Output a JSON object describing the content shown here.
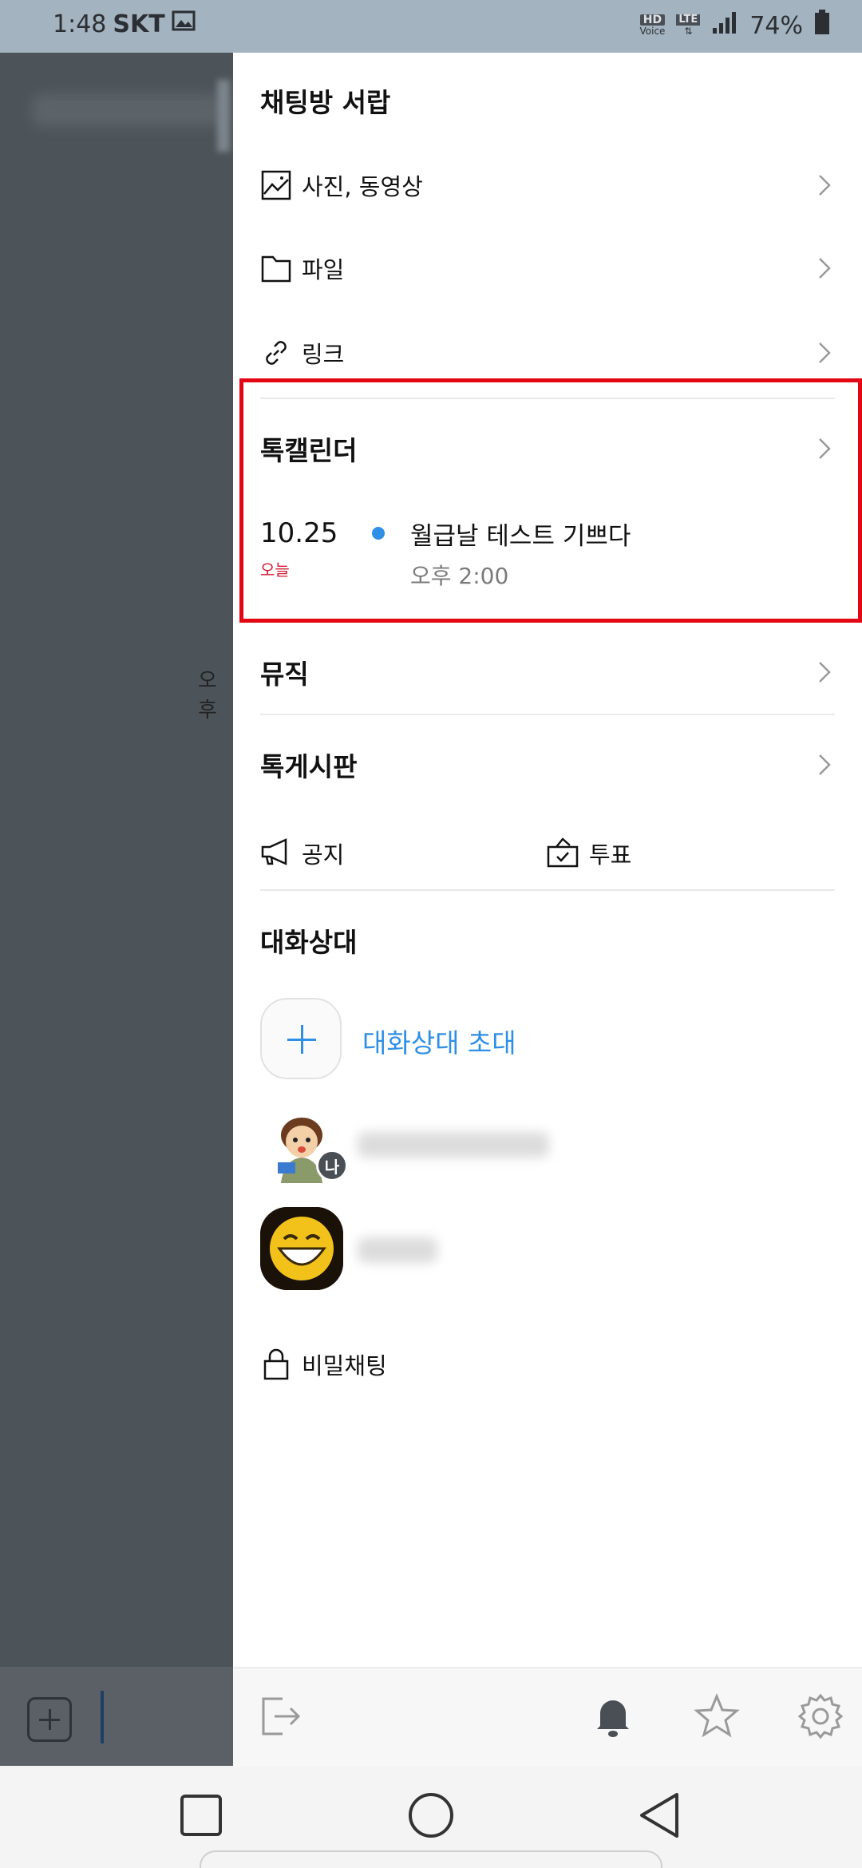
{
  "status_bar": {
    "time": "1:48",
    "carrier": "SKT",
    "hd_voice": "HD",
    "voice": "Voice",
    "lte": "LTE",
    "battery": "74%"
  },
  "background": {
    "time_stub": "오후"
  },
  "drawer": {
    "title": "채팅방 서랍",
    "items": [
      {
        "label": "사진, 동영상",
        "icon": "photo-icon"
      },
      {
        "label": "파일",
        "icon": "folder-icon"
      },
      {
        "label": "링크",
        "icon": "link-icon"
      }
    ],
    "calendar": {
      "title": "톡캘린더",
      "date": "10.25",
      "today_label": "오늘",
      "event_title": "월급날 테스트 기쁘다",
      "event_time": "오후 2:00"
    },
    "music": {
      "title": "뮤직"
    },
    "board": {
      "title": "톡게시판",
      "notice_label": "공지",
      "vote_label": "투표"
    },
    "members": {
      "title": "대화상대",
      "invite_label": "대화상대 초대",
      "me_badge": "나"
    },
    "secret_chat_label": "비밀채팅"
  },
  "colors": {
    "accent_blue": "#2f8fe6",
    "today_red": "#d31b35",
    "highlight_red": "#e30613",
    "dim_bg": "#4d5459"
  }
}
